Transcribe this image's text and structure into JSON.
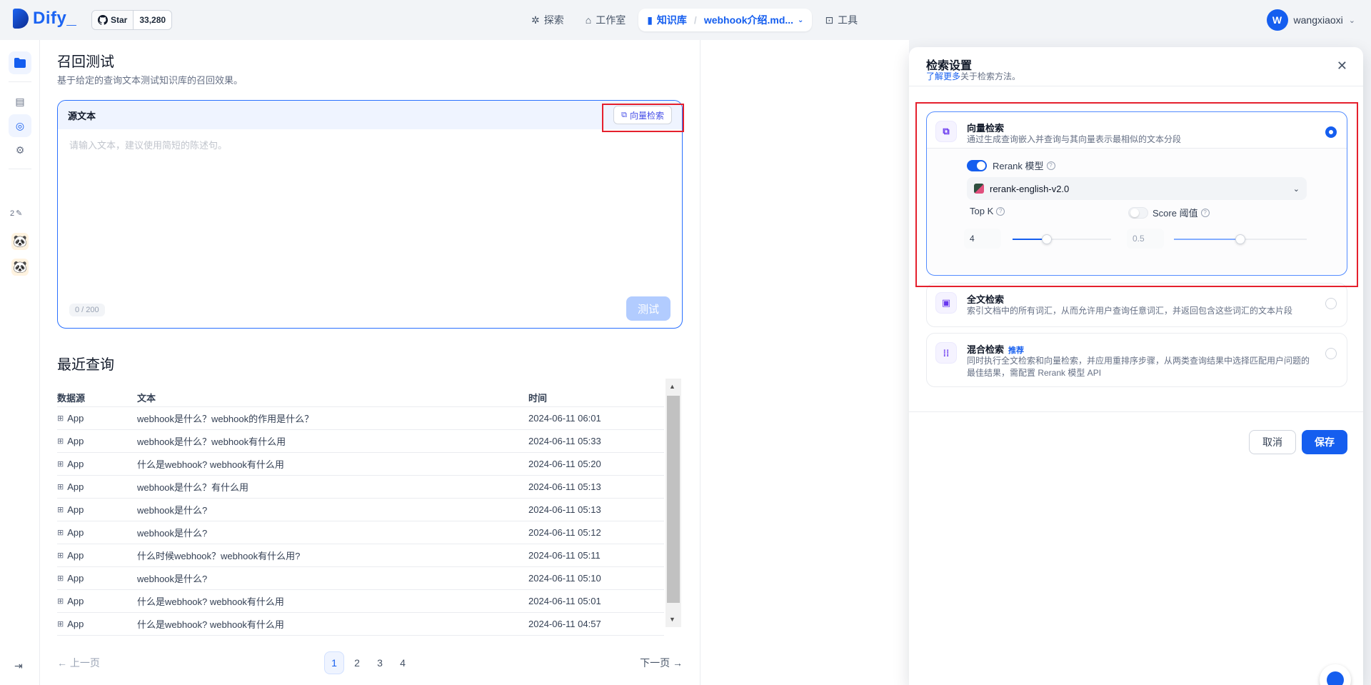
{
  "app": {
    "logo_text": "Dify",
    "github_star_label": "Star",
    "github_star_count": "33,280"
  },
  "nav": {
    "explore": "探索",
    "studio": "工作室",
    "knowledge": "知识库",
    "knowledge_doc": "webhook介绍.md...",
    "tools": "工具"
  },
  "user": {
    "initial": "W",
    "name": "wangxiaoxi"
  },
  "rail": {
    "file_count": "2"
  },
  "main": {
    "title": "召回测试",
    "subtitle": "基于给定的查询文本测试知识库的召回效果。",
    "source_label": "源文本",
    "method_button": "向量检索",
    "placeholder": "请输入文本，建议使用简短的陈述句。",
    "counter": "0 / 200",
    "test_button": "测试",
    "recent_title": "最近查询"
  },
  "table": {
    "headers": [
      "数据源",
      "文本",
      "时间"
    ],
    "rows": [
      {
        "source": "App",
        "text": "webhook是什么？webhook的作用是什么？",
        "time": "2024-06-11 06:01"
      },
      {
        "source": "App",
        "text": "webhook是什么？webhook有什么用",
        "time": "2024-06-11 05:33"
      },
      {
        "source": "App",
        "text": "什么是webhook? webhook有什么用",
        "time": "2024-06-11 05:20"
      },
      {
        "source": "App",
        "text": "webhook是什么？有什么用",
        "time": "2024-06-11 05:13"
      },
      {
        "source": "App",
        "text": "webhook是什么?",
        "time": "2024-06-11 05:13"
      },
      {
        "source": "App",
        "text": "webhook是什么?",
        "time": "2024-06-11 05:12"
      },
      {
        "source": "App",
        "text": "什么时候webhook？webhook有什么用?",
        "time": "2024-06-11 05:11"
      },
      {
        "source": "App",
        "text": "webhook是什么?",
        "time": "2024-06-11 05:10"
      },
      {
        "source": "App",
        "text": "什么是webhook? webhook有什么用",
        "time": "2024-06-11 05:01"
      },
      {
        "source": "App",
        "text": "什么是webhook? webhook有什么用",
        "time": "2024-06-11 04:57"
      }
    ]
  },
  "pager": {
    "prev": "上一页",
    "next": "下一页",
    "pages": [
      "1",
      "2",
      "3",
      "4"
    ],
    "current": "1"
  },
  "drawer": {
    "title": "检索设置",
    "learn_more": "了解更多",
    "sub_suffix": "关于检索方法。",
    "vector": {
      "name": "向量检索",
      "desc": "通过生成查询嵌入并查询与其向量表示最相似的文本分段",
      "rerank_label": "Rerank 模型",
      "rerank_model": "rerank-english-v2.0",
      "topk_label": "Top K",
      "topk_value": "4",
      "score_label": "Score 阈值",
      "score_value": "0.5"
    },
    "fulltext": {
      "name": "全文检索",
      "desc": "索引文档中的所有词汇，从而允许用户查询任意词汇，并返回包含这些词汇的文本片段"
    },
    "hybrid": {
      "name": "混合检索",
      "badge": "推荐",
      "desc": "同时执行全文检索和向量检索，并应用重排序步骤，从两类查询结果中选择匹配用户问题的最佳结果，需配置 Rerank 模型 API"
    },
    "cancel": "取消",
    "save": "保存"
  },
  "colors": {
    "accent": "#155eef",
    "highlight": "#e5202d"
  }
}
